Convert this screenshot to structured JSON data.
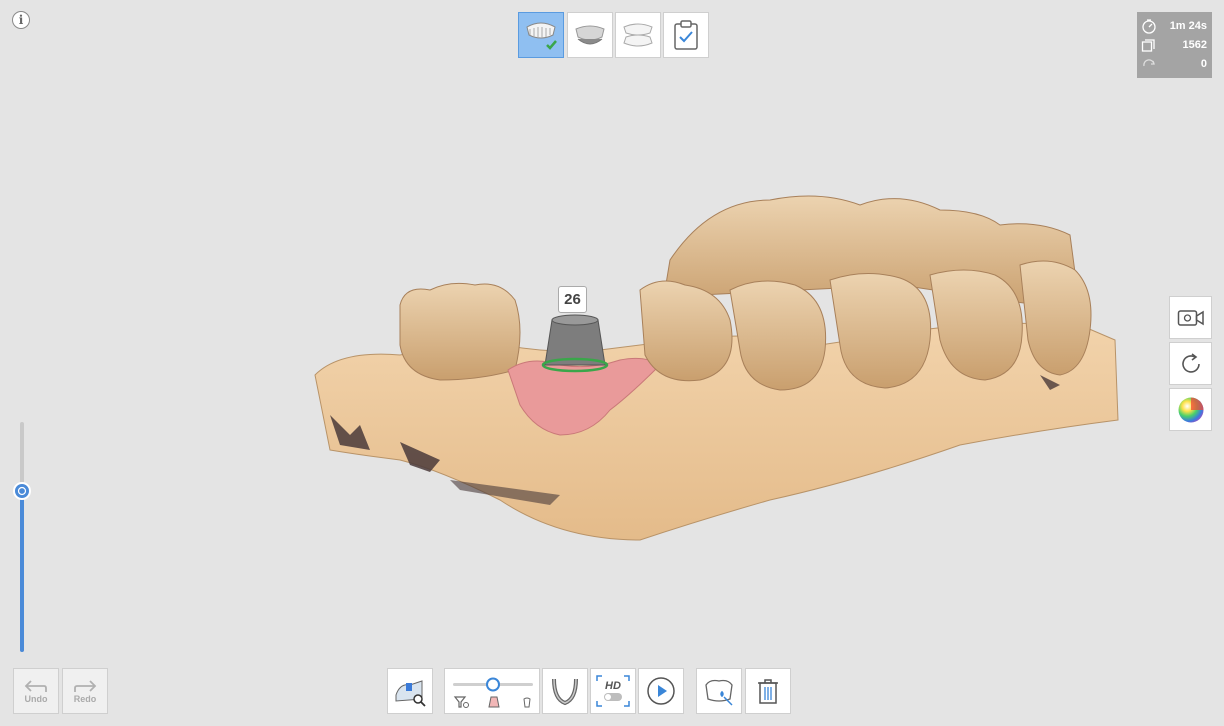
{
  "info": {
    "glyph": "i",
    "icon": "info-icon"
  },
  "stages": [
    {
      "name": "maxilla-stage",
      "active": true,
      "completed": true
    },
    {
      "name": "mandible-stage",
      "active": false,
      "completed": false
    },
    {
      "name": "occlusion-stage",
      "active": false,
      "completed": false
    },
    {
      "name": "review-stage",
      "active": false,
      "completed": false
    }
  ],
  "stats": {
    "time": "1m 24s",
    "frames": "1562",
    "rotation": "0"
  },
  "tooth_label": "26",
  "history": {
    "undo_label": "Undo",
    "redo_label": "Redo"
  },
  "colors": {
    "accent": "#4a8ad8",
    "active_stage": "#8fbff1",
    "background": "#e4e4e4",
    "stats_bg": "#a4a4a4"
  }
}
